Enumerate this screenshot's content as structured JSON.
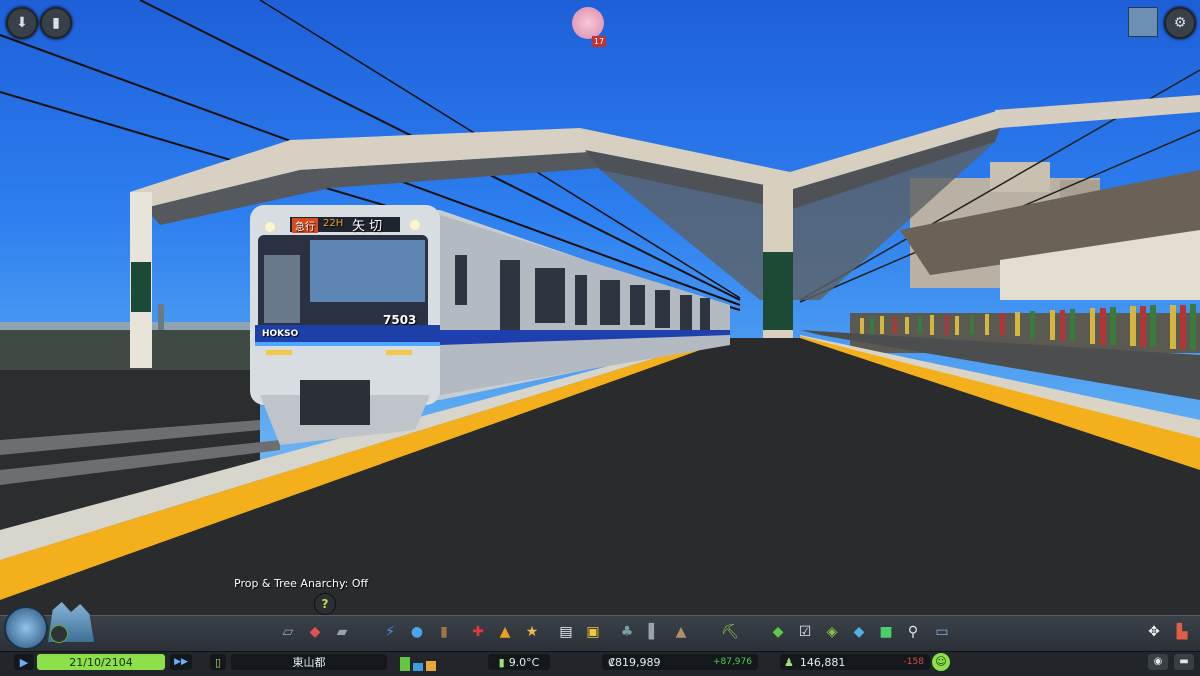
{
  "overlay": {
    "prop_anarchy_label": "Prop & Tree Anarchy: Off",
    "help_glyph": "?",
    "notification_count": "17"
  },
  "train": {
    "number": "7503",
    "destination": "矢 切",
    "service_badge": "急行",
    "route_code": "22H",
    "brand": "HOKSO"
  },
  "status": {
    "date": "21/10/2104",
    "district": "東山都",
    "temperature": "9.0°C",
    "money": "₡819,989",
    "money_delta": "+87,976",
    "population": "146,881",
    "population_delta": "-158"
  },
  "icons": {
    "top_left": [
      "download-arrow-icon",
      "traffic-light-icon"
    ],
    "top_right": [
      "city-logo-icon",
      "gear-icon"
    ],
    "toolbar": [
      "roads-icon",
      "zoning-icon",
      "districts-icon",
      "electricity-icon",
      "water-icon",
      "garbage-icon",
      "healthcare-icon",
      "fire-icon",
      "police-icon",
      "education-icon",
      "public-transport-icon",
      "parks-icon",
      "unique-buildings-icon",
      "monuments-icon",
      "landscaping-icon",
      "money-icon",
      "policies-icon",
      "info-views-icon",
      "water-tool-icon",
      "terrain-icon",
      "search-icon",
      "photo-mode-icon"
    ]
  },
  "colors": {
    "accent_green": "#8ce04a",
    "delta_positive": "#4fc94f",
    "delta_negative": "#e04848",
    "platform_yellow": "#f4b01c"
  }
}
